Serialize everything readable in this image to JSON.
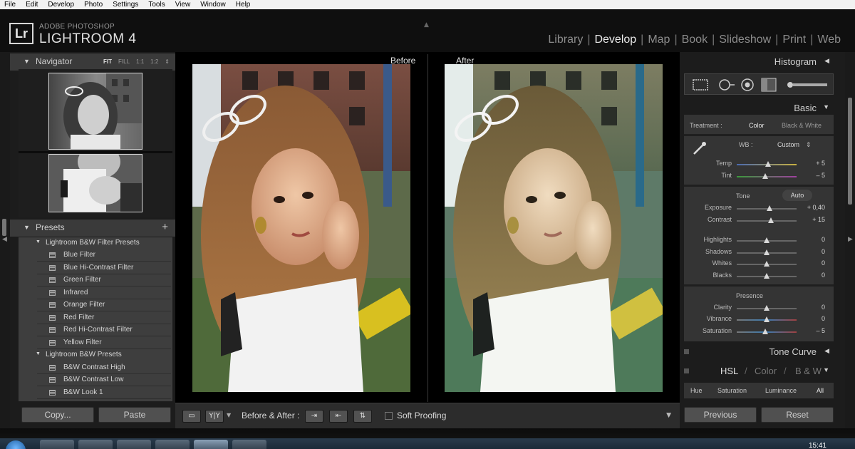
{
  "menu": [
    "File",
    "Edit",
    "Develop",
    "Photo",
    "Settings",
    "Tools",
    "View",
    "Window",
    "Help"
  ],
  "brand": {
    "logo": "Lr",
    "top": "ADOBE PHOTOSHOP",
    "main": "LIGHTROOM 4"
  },
  "modules": [
    {
      "label": "Library",
      "active": false
    },
    {
      "label": "Develop",
      "active": true
    },
    {
      "label": "Map",
      "active": false
    },
    {
      "label": "Book",
      "active": false
    },
    {
      "label": "Slideshow",
      "active": false
    },
    {
      "label": "Print",
      "active": false
    },
    {
      "label": "Web",
      "active": false
    }
  ],
  "navigator": {
    "title": "Navigator",
    "options": [
      "FIT",
      "FILL",
      "1:1",
      "1:2"
    ],
    "active": "FIT"
  },
  "presets": {
    "title": "Presets",
    "add": "+",
    "folders": [
      {
        "label": "Lightroom B&W Filter Presets",
        "items": [
          "Blue Filter",
          "Blue Hi-Contrast Filter",
          "Green Filter",
          "Infrared",
          "Orange Filter",
          "Red Filter",
          "Red Hi-Contrast Filter",
          "Yellow Filter"
        ]
      },
      {
        "label": "Lightroom B&W Presets",
        "items": [
          "B&W Contrast High",
          "B&W Contrast Low",
          "B&W Look 1"
        ]
      }
    ]
  },
  "left_buttons": {
    "copy": "Copy...",
    "paste": "Paste"
  },
  "view": {
    "before": "Before",
    "after": "After"
  },
  "toolbar": {
    "before_after": "Before & After :",
    "soft_proofing": "Soft Proofing",
    "yy": "Y|Y"
  },
  "histogram": {
    "title": "Histogram"
  },
  "basic": {
    "title": "Basic",
    "treatment_label": "Treatment :",
    "treatment_color": "Color",
    "treatment_bw": "Black & White",
    "wb_label": "WB :",
    "wb_value": "Custom",
    "tone_label": "Tone",
    "auto": "Auto",
    "presence_label": "Presence",
    "sliders": [
      {
        "key": "temp",
        "label": "Temp",
        "value": "+ 5",
        "pos": 0.52
      },
      {
        "key": "tint",
        "label": "Tint",
        "value": "– 5",
        "pos": 0.48
      },
      {
        "key": "exposure",
        "label": "Exposure",
        "value": "+ 0,40",
        "pos": 0.55
      },
      {
        "key": "contrast",
        "label": "Contrast",
        "value": "+ 15",
        "pos": 0.57
      },
      {
        "key": "highlights",
        "label": "Highlights",
        "value": "0",
        "pos": 0.5
      },
      {
        "key": "shadows",
        "label": "Shadows",
        "value": "0",
        "pos": 0.5
      },
      {
        "key": "whites",
        "label": "Whites",
        "value": "0",
        "pos": 0.5
      },
      {
        "key": "blacks",
        "label": "Blacks",
        "value": "0",
        "pos": 0.5
      },
      {
        "key": "clarity",
        "label": "Clarity",
        "value": "0",
        "pos": 0.5
      },
      {
        "key": "vibrance",
        "label": "Vibrance",
        "value": "0",
        "pos": 0.5
      },
      {
        "key": "saturation",
        "label": "Saturation",
        "value": "– 5",
        "pos": 0.48
      }
    ]
  },
  "tone_curve": {
    "title": "Tone Curve"
  },
  "hsl": {
    "title_hsl": "HSL",
    "title_color": "Color",
    "title_bw": "B & W",
    "tabs": [
      "Hue",
      "Saturation",
      "Luminance",
      "All"
    ]
  },
  "right_buttons": {
    "previous": "Previous",
    "reset": "Reset"
  },
  "taskbar": {
    "clock": "15:41"
  },
  "icons": [
    "lr-logo",
    "collapse-triangle-icon",
    "preset-icon",
    "add-icon",
    "eyedropper-icon",
    "crop-icon",
    "spot-removal-icon",
    "red-eye-icon",
    "graduated-filter-icon",
    "adjustment-brush-icon"
  ]
}
